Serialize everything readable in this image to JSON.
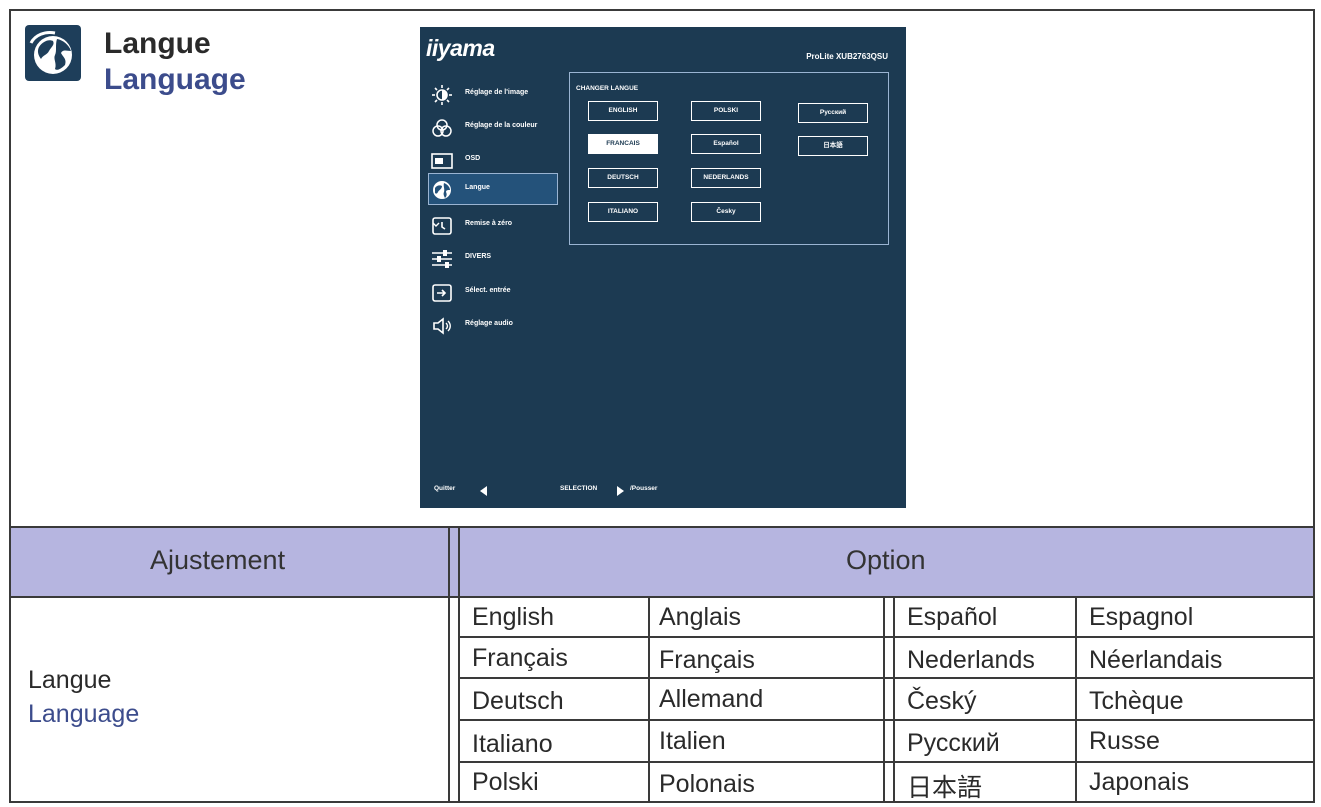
{
  "header": {
    "title_fr": "Langue",
    "title_en": "Language",
    "icon": "globe-icon"
  },
  "osd": {
    "brand": "iiyama",
    "model": "ProLite XUB2763QSU",
    "menu": [
      {
        "label": "Réglage de l'image",
        "icon": "brightness-icon"
      },
      {
        "label": "Réglage de la couleur",
        "icon": "color-icon"
      },
      {
        "label": "OSD",
        "icon": "osd-icon"
      },
      {
        "label": "Langue",
        "icon": "globe-icon",
        "selected": true
      },
      {
        "label": "Remise à zéro",
        "icon": "reset-icon"
      },
      {
        "label": "DIVERS",
        "icon": "sliders-icon"
      },
      {
        "label": "Sélect. entrée",
        "icon": "input-icon"
      },
      {
        "label": "Réglage audio",
        "icon": "speaker-icon"
      }
    ],
    "panel_title": "CHANGER LANGUE",
    "languages": [
      {
        "label": "ENGLISH"
      },
      {
        "label": "POLSKI"
      },
      {
        "label": "Русский"
      },
      {
        "label": "FRANCAIS",
        "active": true
      },
      {
        "label": "Español"
      },
      {
        "label": "日本語"
      },
      {
        "label": "DEUTSCH"
      },
      {
        "label": "NEDERLANDS"
      },
      {
        "label": "ITALIANO"
      },
      {
        "label": "Česky"
      }
    ],
    "footer_quit": "Quitter",
    "footer_select": "SELECTION",
    "footer_push": "/Pousser"
  },
  "table": {
    "col_adjust": "Ajustement",
    "col_option": "Option",
    "adjust_fr": "Langue",
    "adjust_en": "Language",
    "rows": [
      [
        "English",
        "Anglais",
        "Español",
        "Espagnol"
      ],
      [
        "Français",
        "Français",
        "Nederlands",
        "Néerlandais"
      ],
      [
        "Deutsch",
        "Allemand",
        "Český",
        "Tchèque"
      ],
      [
        "Italiano",
        "Italien",
        "Русский",
        "Russe"
      ],
      [
        "Polski",
        "Polonais",
        "日本語",
        "Japonais"
      ]
    ]
  }
}
